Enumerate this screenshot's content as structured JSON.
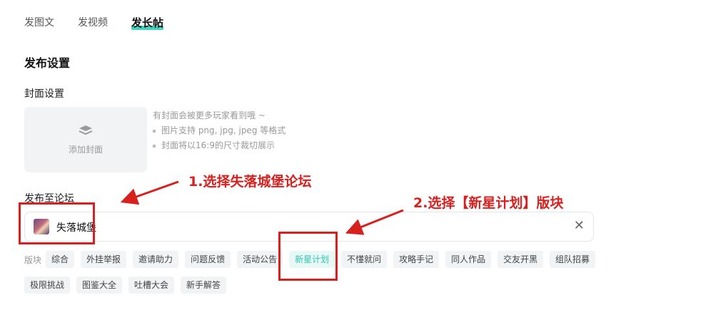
{
  "tabs": [
    {
      "label": "发图文",
      "active": false
    },
    {
      "label": "发视频",
      "active": false
    },
    {
      "label": "发长帖",
      "active": true
    }
  ],
  "section_title": "发布设置",
  "cover": {
    "label": "封面设置",
    "button_label": "添加封面",
    "hint_title": "有封面会被更多玩家看到哦 ~",
    "hint_items": [
      "图片支持 png, jpg, jpeg 等格式",
      "封面将以16:9的尺寸裁切展示"
    ]
  },
  "forum": {
    "label": "发布至论坛",
    "selected_name": "失落城堡",
    "clear_icon": "close-icon",
    "clear_glyph": "✕"
  },
  "boards": {
    "label": "版块",
    "row1": [
      "综合",
      "外挂举报",
      "邀请助力",
      "问题反馈",
      "活动公告",
      "新星计划",
      "不懂就问",
      "攻略手记",
      "同人作品",
      "交友开黑",
      "组队招募"
    ],
    "row2": [
      "极限挑战",
      "图鉴大全",
      "吐槽大会",
      "新手解答"
    ],
    "selected": "新星计划"
  },
  "annotations": {
    "step1": "1.选择失落城堡论坛",
    "step2": "2.选择【新星计划】版块"
  },
  "colors": {
    "accent": "#2fc7b4",
    "annotation": "#d8201e"
  }
}
